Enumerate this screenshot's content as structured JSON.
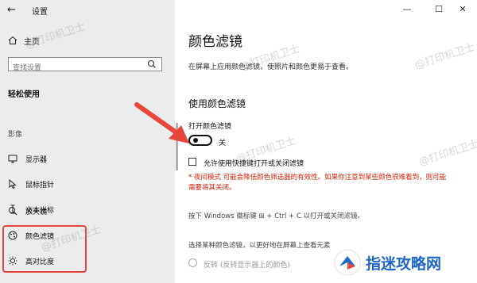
{
  "window": {
    "title": "设置",
    "back_icon": "back-arrow-icon",
    "controls": [
      "minimize-icon",
      "maximize-icon",
      "close-icon"
    ]
  },
  "sidebar": {
    "home_label": "主页",
    "search_placeholder": "查找设置",
    "group_title": "轻松使用",
    "section_label": "影像",
    "items": [
      {
        "label": "显示器",
        "icon": "display-icon"
      },
      {
        "label": "鼠标指针",
        "icon": "mouse-pointer-icon"
      },
      {
        "label": "文本光标",
        "icon": "text-cursor-icon"
      },
      {
        "label": "放大镜",
        "icon": "magnifier-icon"
      },
      {
        "label": "颜色滤镜",
        "icon": "color-filter-icon"
      },
      {
        "label": "高对比度",
        "icon": "high-contrast-icon"
      }
    ],
    "highlight_color": "#e8453c"
  },
  "main": {
    "page_title": "颜色滤镜",
    "description": "在屏幕上应用颜色滤镜，使照片和颜色更易于查看。",
    "section_title": "使用颜色滤镜",
    "toggle": {
      "label": "打开颜色滤镜",
      "state": "关",
      "on": false
    },
    "checkbox": {
      "label": "允许使用快捷键打开或关闭滤镜",
      "checked": false
    },
    "warning": "* 夜间模式 可能会降低颜色筛选器的有效性。如果你注意到某些颜色很难看到，则可能需要将其关闭。",
    "warning_color": "#d81e06",
    "shortcut": "按下 Windows 徽标键 ⊞ + Ctrl + C 以打开或关闭滤镜。",
    "choose": "选择某种颜色滤镜，以更好地在屏幕上查看元素",
    "radio_label": "反转 (反转显示器上的颜色)"
  },
  "watermark": "@打印机卫士",
  "logo": {
    "text": "指迷攻略网",
    "color": "#1e66c8"
  }
}
